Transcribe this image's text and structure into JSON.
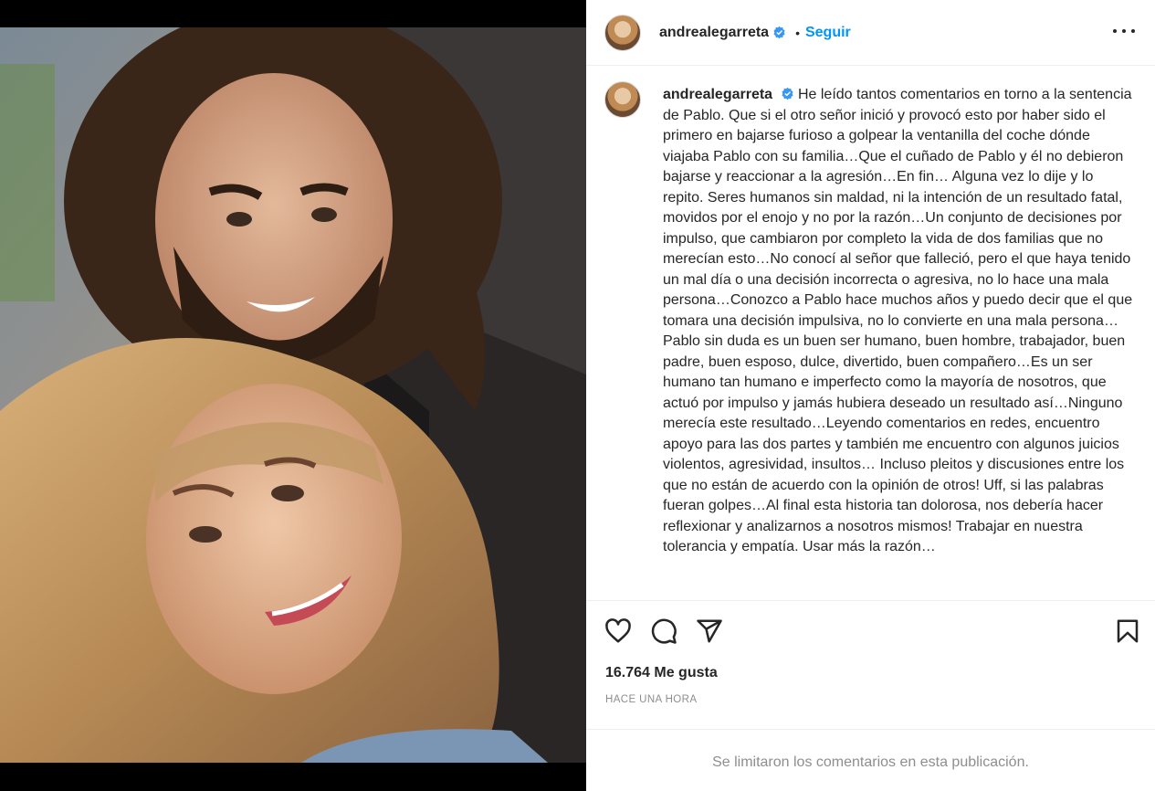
{
  "post": {
    "username": "andrealegarreta",
    "follow_label": "Seguir",
    "separator": "•",
    "caption": "He leído tantos comentarios en torno a la sentencia de Pablo. Que si el otro señor inició y provocó esto por haber sido el primero en bajarse furioso a golpear la ventanilla del coche dónde viajaba Pablo con su familia…Que el cuñado de Pablo y él no debieron bajarse y reaccionar a la agresión…En fin… Alguna vez lo dije y lo repito. Seres humanos sin maldad, ni la intención de un resultado fatal, movidos por el enojo y no por la razón…Un conjunto de decisiones por impulso, que cambiaron por completo la vida de dos familias que no merecían esto…No conocí al señor que falleció, pero el que haya tenido un mal día o una decisión incorrecta o agresiva, no lo hace una mala persona…Conozco a Pablo hace muchos años y puedo decir que el que tomara una decisión impulsiva, no lo convierte en una mala persona… Pablo sin duda es un buen ser humano, buen hombre, trabajador, buen padre, buen esposo, dulce, divertido, buen compañero…Es un ser humano tan humano e imperfecto como la mayoría de nosotros, que actuó por impulso y jamás hubiera deseado un resultado así…Ninguno merecía este resultado…Leyendo comentarios en redes, encuentro apoyo para las dos partes y también me encuentro con algunos juicios violentos, agresividad, insultos… Incluso pleitos y discusiones entre los que no están de acuerdo con la opinión de otros! Uff, si las palabras fueran golpes…Al final esta historia tan dolorosa, nos debería hacer reflexionar y analizarnos a nosotros mismos! Trabajar en nuestra tolerancia y empatía. Usar más la razón…",
    "likes": "16.764 Me gusta",
    "timestamp": "HACE UNA HORA",
    "comments_limited": "Se limitaron los comentarios en esta publicación."
  },
  "icons": {
    "like": "heart-icon",
    "comment": "comment-icon",
    "share": "share-icon",
    "save": "bookmark-icon",
    "more": "more-options-icon",
    "verified": "verified-badge-icon"
  },
  "colors": {
    "follow": "#0095f6",
    "verified": "#3897f0",
    "muted": "#8e8e8e",
    "text": "#262626"
  }
}
